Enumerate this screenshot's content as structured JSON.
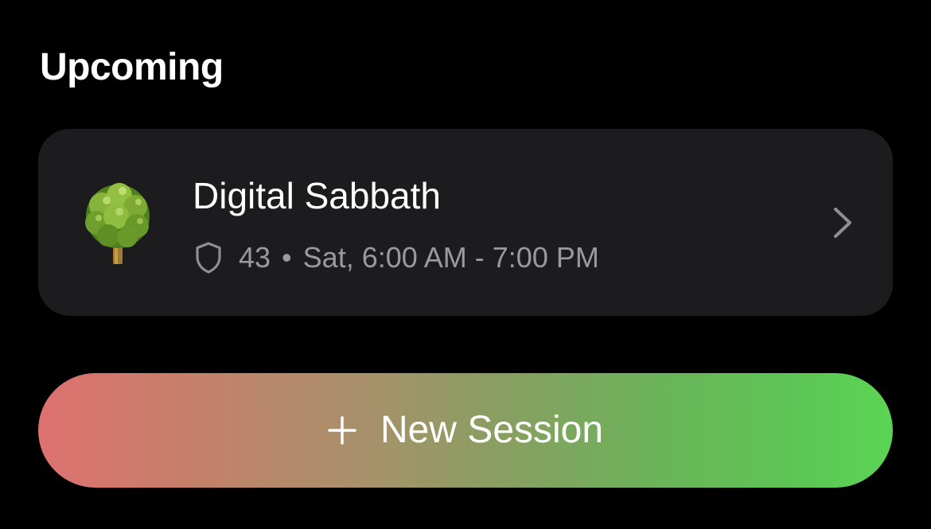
{
  "upcoming": {
    "title": "Upcoming"
  },
  "session": {
    "icon": "tree-icon",
    "name": "Digital Sabbath",
    "shield_icon": "shield-icon",
    "count": "43",
    "separator": "•",
    "schedule": "Sat, 6:00 AM - 7:00 PM",
    "chevron_icon": "chevron-right-icon"
  },
  "new_session": {
    "icon": "plus-icon",
    "label": "New Session",
    "gradient_start": "#dd7170",
    "gradient_end": "#5bd453"
  },
  "colors": {
    "background": "#000000",
    "card": "#1c1c1e",
    "secondary_text": "#9a9a9e",
    "primary_text": "#ffffff"
  }
}
